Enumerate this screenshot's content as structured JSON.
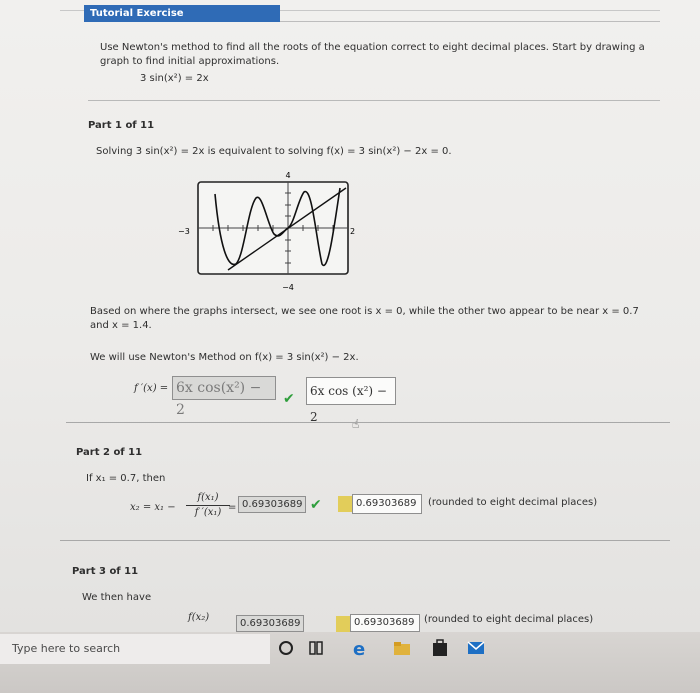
{
  "header": {
    "title": "Tutorial Exercise"
  },
  "problem": {
    "line1": "Use Newton's method to find all the roots of the equation correct to eight decimal places. Start by drawing a",
    "line2": "graph to find initial approximations.",
    "equation": "3 sin(x²) = 2x"
  },
  "part1": {
    "label": "Part 1 of 11",
    "solving_text": "Solving 3 sin(x²) = 2x is equivalent to solving f(x) = 3 sin(x²) − 2x = 0.",
    "graph": {
      "y_top": "4",
      "y_bottom": "−4",
      "x_left": "−3",
      "x_right": "2"
    },
    "based_line1": "Based on where the graphs intersect, we see one root is x = 0, while the other two appear to be near x = 0.7",
    "based_line2": "and x = 1.4.",
    "newton_text": "We will use Newton's Method on f(x) = 3 sin(x²) − 2x.",
    "fprime_label": "f ′(x) =",
    "fprime_answer": "6x cos(x²) − 2",
    "fprime_answer_box": "6x cos (x²) − 2"
  },
  "part2": {
    "label": "Part 2 of 11",
    "if_text": "If x₁ = 0.7, then",
    "x2_lhs": "x₂ = x₁ −",
    "frac_num": "f(x₁)",
    "frac_den": "f ′(x₁)",
    "eq_sign": "=",
    "answer_value": "0.69303689",
    "rounded_value": "0.69303689",
    "rounded_note": "(rounded to eight decimal places)"
  },
  "part3": {
    "label": "Part 3 of 11",
    "we_then": "We then have",
    "partial_frac": "f(x₂)",
    "partial_box1": "0.69303689",
    "partial_box2": "0.69303689",
    "partial_note": "(rounded to eight decimal places)"
  },
  "taskbar": {
    "search_placeholder": "Type here to search"
  }
}
